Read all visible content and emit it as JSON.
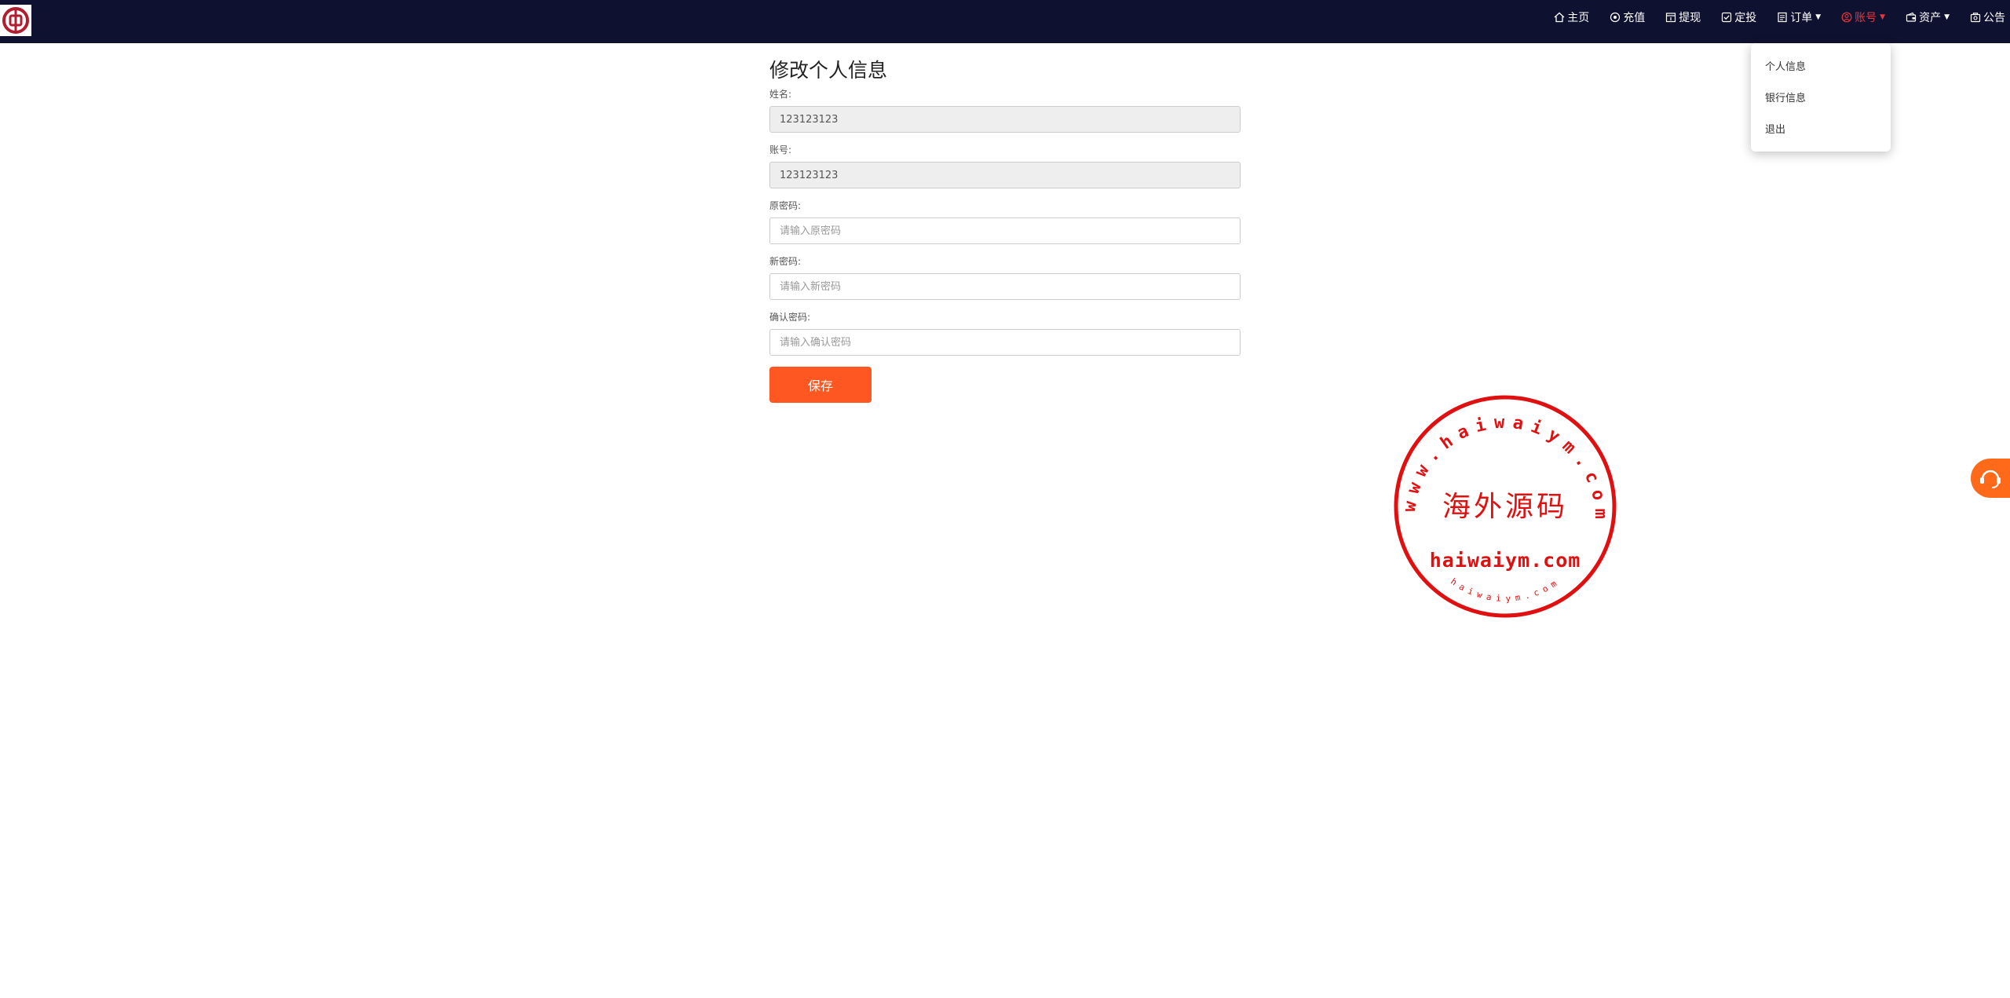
{
  "nav": {
    "items": [
      {
        "label": "主页",
        "icon": "home-icon"
      },
      {
        "label": "充值",
        "icon": "recharge-icon"
      },
      {
        "label": "提现",
        "icon": "withdraw-icon"
      },
      {
        "label": "定投",
        "icon": "check-square-icon"
      },
      {
        "label": "订单",
        "icon": "order-icon"
      },
      {
        "label": "账号",
        "icon": "user-circle-icon"
      },
      {
        "label": "资产",
        "icon": "wallet-icon"
      },
      {
        "label": "公告",
        "icon": "notice-icon"
      }
    ],
    "active_color": "#e8363a"
  },
  "dropdown": {
    "items": [
      "个人信息",
      "银行信息",
      "退出"
    ]
  },
  "form": {
    "title": "修改个人信息",
    "name_label": "姓名:",
    "name_value": "123123123",
    "account_label": "账号:",
    "account_value": "123123123",
    "old_pw_label": "原密码:",
    "old_pw_placeholder": "请输入原密码",
    "new_pw_label": "新密码:",
    "new_pw_placeholder": "请输入新密码",
    "confirm_pw_label": "确认密码:",
    "confirm_pw_placeholder": "请输入确认密码",
    "save_label": "保存"
  },
  "stamp": {
    "arc_text": "www.haiwaiym.com",
    "center_text": "海外源码",
    "bottom_text": "haiwaiym.com",
    "small_arc_text": "haiwaiym.com",
    "color": "#e01010"
  },
  "colors": {
    "topbar": "#0f1130",
    "primary_button": "#ff5722",
    "service_button": "#ff6a1a"
  }
}
